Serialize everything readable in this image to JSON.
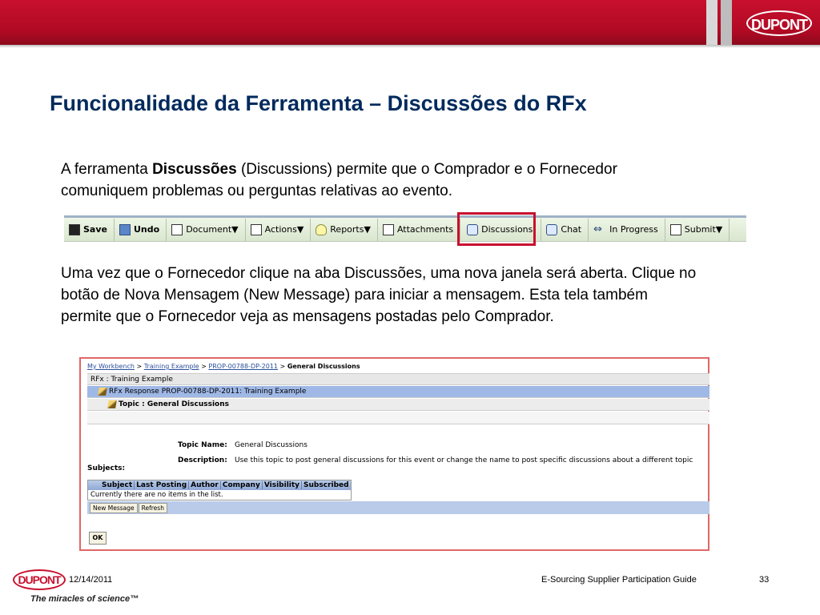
{
  "header": {
    "logo_text": "DUPONT",
    "brand_color": "#c8102e"
  },
  "slide": {
    "title": "Funcionalidade da Ferramenta – Discussões do RFx",
    "para1": {
      "pre": "A ferramenta ",
      "bold": "Discussões",
      "post": " (Discussions) permite que o Comprador  e o Fornecedor comuniquem problemas ou perguntas relativas ao evento."
    },
    "para2": "Uma vez que o Fornecedor clique na aba Discussões, uma nova janela será aberta.  Clique no botão de Nova Mensagem (New Message) para iniciar a mensagem. Esta tela também permite que o Fornecedor veja as mensagens postadas pelo Comprador."
  },
  "toolbar": {
    "save": "Save",
    "undo": "Undo",
    "document": "Document▼",
    "actions": "Actions▼",
    "reports": "Reports▼",
    "attachments": "Attachments",
    "discussions": "Discussions",
    "chat": "Chat",
    "in_progress": "In Progress",
    "submit": "Submit▼"
  },
  "app": {
    "breadcrumb": {
      "b1": "My Workbench",
      "sep": " > ",
      "b2": "Training Example",
      "b3": "PROP-00788-DP-2011",
      "current": "General Discussions"
    },
    "rfx_row": "RFx : Training Example",
    "response_row": "RFx Response PROP-00788-DP-2011: Training Example",
    "topic_row": "Topic : General Discussions",
    "topic_name_label": "Topic Name:",
    "topic_name_value": "General Discussions",
    "description_label": "Description:",
    "description_value": "Use this topic to post general discussions for this event or change the name to post specific discussions about a different topic",
    "subjects_label": "Subjects:",
    "columns": [
      "Subject",
      "Last Posting",
      "Author",
      "Company",
      "Visibility",
      "Subscribed"
    ],
    "empty_message": "Currently there are no items in the list.",
    "new_message": "New Message",
    "refresh": "Refresh",
    "ok": "OK"
  },
  "footer": {
    "logo_text": "DUPONT",
    "tagline": "The miracles of science™",
    "date": "12/14/2011",
    "guide": "E-Sourcing Supplier Participation Guide",
    "page": "33"
  }
}
